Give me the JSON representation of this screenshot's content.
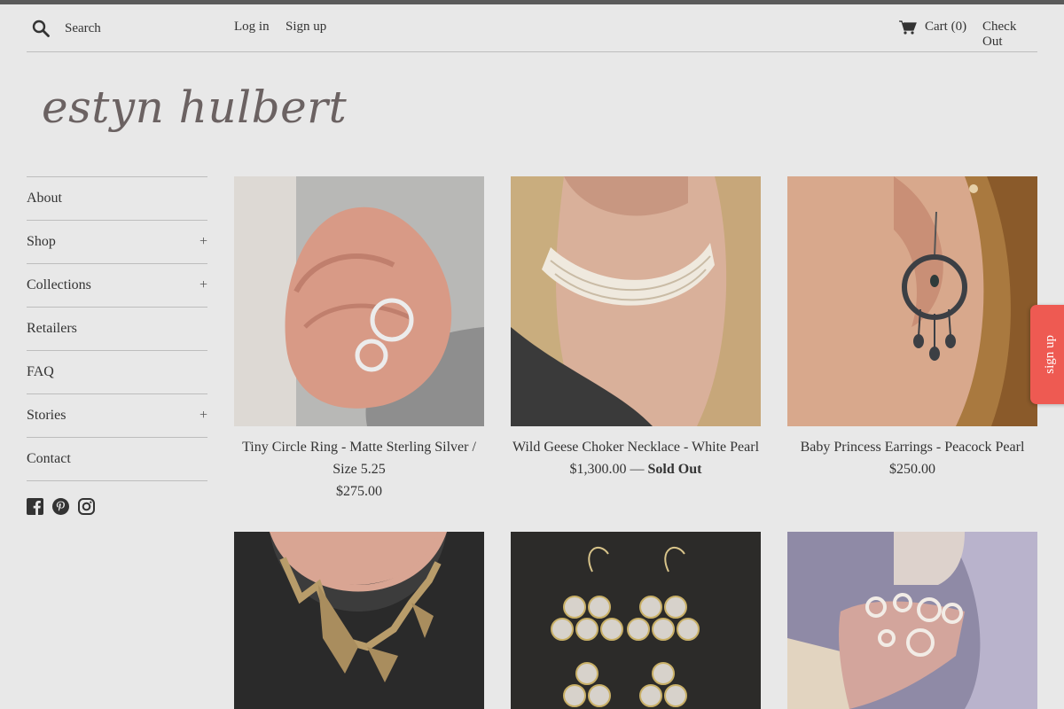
{
  "header": {
    "search_placeholder": "Search",
    "login": "Log in",
    "signup": "Sign up",
    "cart": "Cart (0)",
    "checkout": "Check Out"
  },
  "logo": "estyn hulbert",
  "nav": {
    "items": [
      {
        "label": "About"
      },
      {
        "label": "Shop",
        "expand": "+"
      },
      {
        "label": "Collections",
        "expand": "+"
      },
      {
        "label": "Retailers"
      },
      {
        "label": "FAQ"
      },
      {
        "label": "Stories",
        "expand": "+"
      },
      {
        "label": "Contact"
      }
    ]
  },
  "social": [
    "facebook-icon",
    "pinterest-icon",
    "instagram-icon"
  ],
  "products": [
    {
      "title": "Tiny Circle Ring - Matte Sterling Silver / Size 5.25",
      "price": "$275.00"
    },
    {
      "title": "Wild Geese Choker Necklace - White Pearl",
      "price": "$1,300.00",
      "sep": " — ",
      "status": "Sold Out"
    },
    {
      "title": "Baby Princess Earrings - Peacock Pearl",
      "price": "$250.00"
    },
    {
      "title": "",
      "price": ""
    },
    {
      "title": "",
      "price": ""
    },
    {
      "title": "",
      "price": ""
    }
  ],
  "signup_tab": "sign up",
  "colors": {
    "background": "#e8e8e8",
    "signup_tab": "#ee5a52",
    "logo": "#6b6262"
  }
}
